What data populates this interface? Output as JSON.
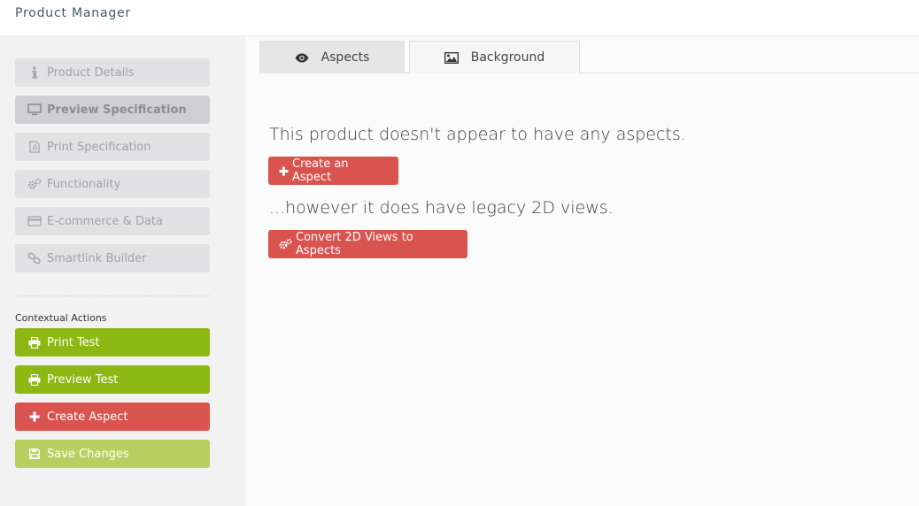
{
  "app": {
    "title": "Product Manager"
  },
  "sidebar": {
    "nav": [
      {
        "label": "Product Details",
        "icon": "info-icon"
      },
      {
        "label": "Preview Specification",
        "icon": "monitor-icon"
      },
      {
        "label": "Print Specification",
        "icon": "pdf-file-icon"
      },
      {
        "label": "Functionality",
        "icon": "gears-icon"
      },
      {
        "label": "E-commerce & Data",
        "icon": "credit-card-icon"
      },
      {
        "label": "Smartlink Builder",
        "icon": "link-icon"
      }
    ],
    "contextual_label": "Contextual Actions",
    "actions": [
      {
        "label": "Print Test",
        "icon": "printer-icon",
        "color": "#8db712"
      },
      {
        "label": "Preview Test",
        "icon": "printer-icon",
        "color": "#8db712"
      },
      {
        "label": "Create Aspect",
        "icon": "plus-icon",
        "color": "#d9534f"
      },
      {
        "label": "Save Changes",
        "icon": "floppy-icon",
        "color": "#b7d160"
      }
    ]
  },
  "tabs": [
    {
      "label": "Aspects",
      "icon": "eye-icon",
      "active": true
    },
    {
      "label": "Background",
      "icon": "image-icon",
      "active": false
    }
  ],
  "main": {
    "no_aspects_message": "This product doesn't appear to have any aspects.",
    "create_button": "Create an Aspect",
    "legacy_message": "...however it does have legacy 2D views.",
    "convert_button": "Convert 2D Views to Aspects"
  }
}
